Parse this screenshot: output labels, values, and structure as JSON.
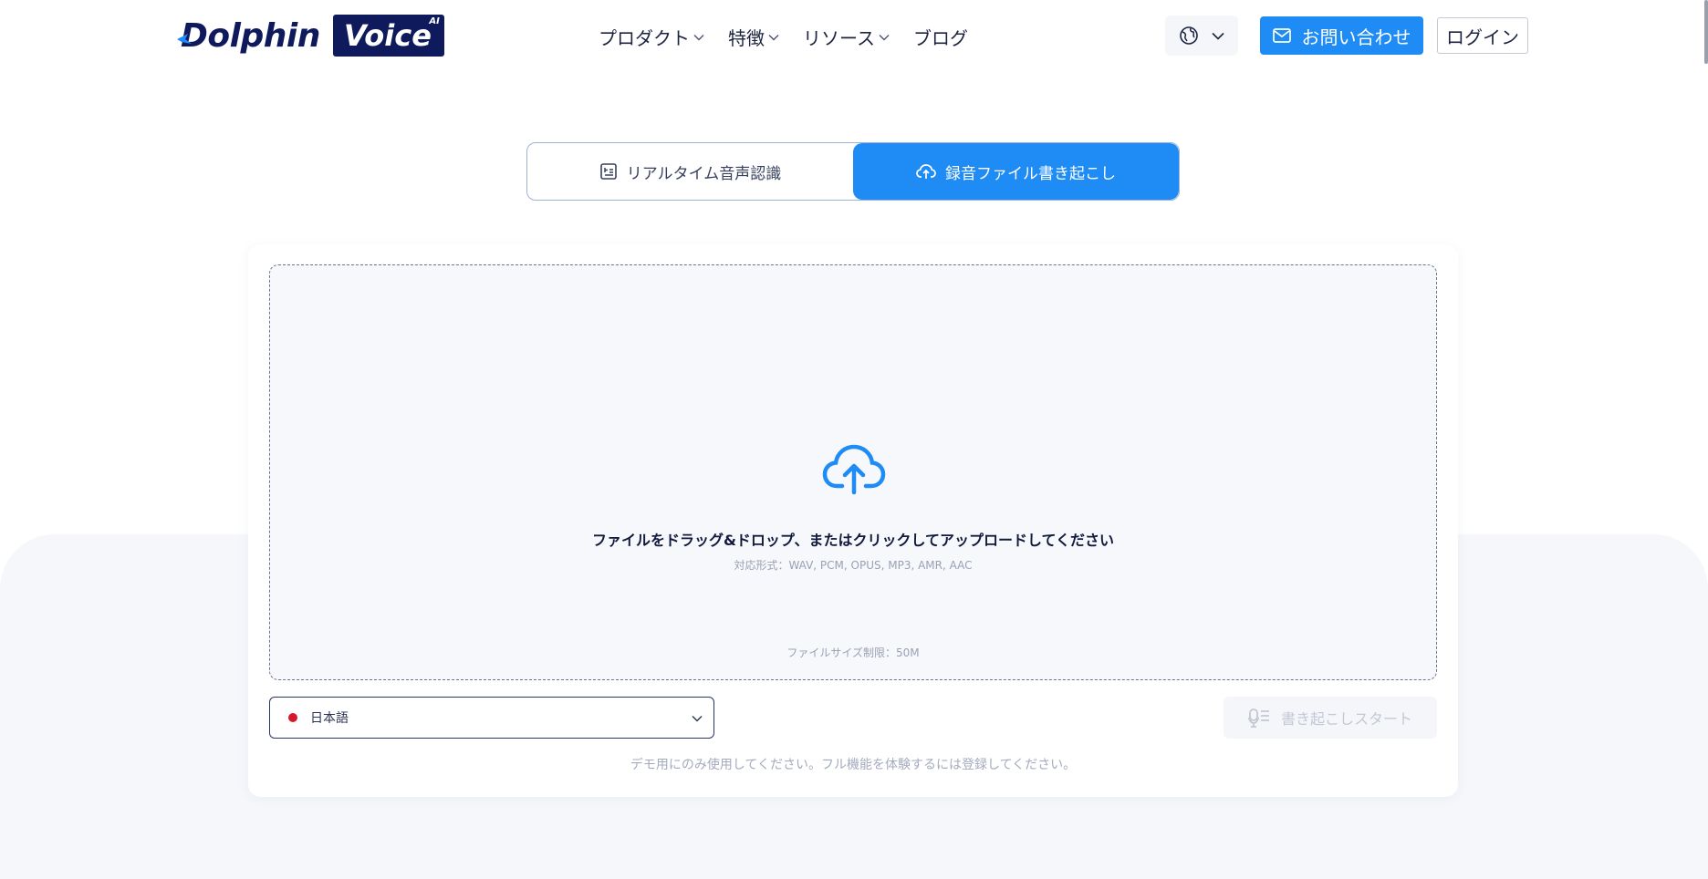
{
  "header": {
    "logo": {
      "word1": "Dolphin",
      "word2": "Voice",
      "badge": "AI"
    },
    "nav": [
      {
        "label": "プロダクト",
        "has_dropdown": true
      },
      {
        "label": "特徴",
        "has_dropdown": true
      },
      {
        "label": "リソース",
        "has_dropdown": true
      },
      {
        "label": "ブログ",
        "has_dropdown": false
      }
    ],
    "language_button_icon": "globe-icon",
    "contact_label": "お問い合わせ",
    "login_label": "ログイン"
  },
  "mode_toggle": {
    "tabs": [
      {
        "label": "リアルタイム音声認識",
        "icon": "transcript-icon",
        "active": false
      },
      {
        "label": "録音ファイル書き起こし",
        "icon": "cloud-upload-icon",
        "active": true
      }
    ]
  },
  "upload": {
    "title": "ファイルをドラッグ&ドロップ、またはクリックしてアップロードしてください",
    "formats": "対応形式：WAV, PCM, OPUS, MP3, AMR, AAC",
    "size_limit": "ファイルサイズ制限：50M"
  },
  "language_select": {
    "value": "日本語"
  },
  "start_button": {
    "label": "書き起こしスタート",
    "enabled": false
  },
  "demo_note": "デモ用にのみ使用してください。フル機能を体験するには登録してください。",
  "colors": {
    "primary": "#1f8cf5",
    "brand_navy": "#0f1a5c",
    "flag_red": "#d6182b"
  }
}
